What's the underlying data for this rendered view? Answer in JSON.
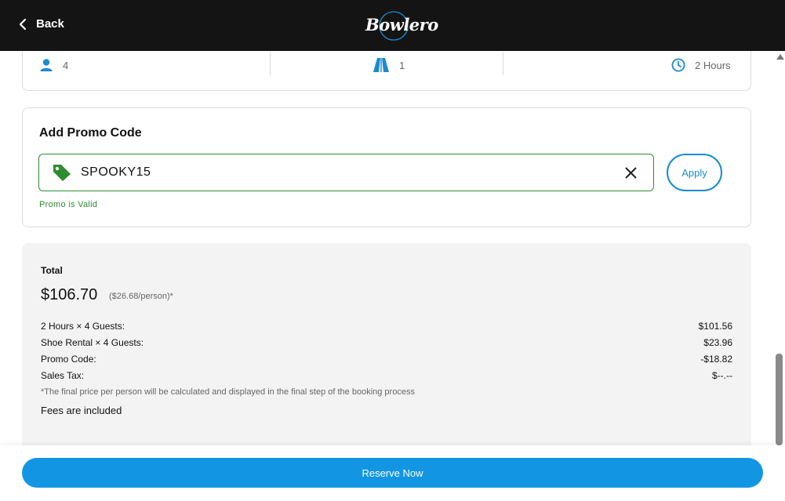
{
  "header": {
    "back_label": "Back",
    "logo_text": "Bowlero"
  },
  "summary": {
    "guests": "4",
    "lanes": "1",
    "duration": "2 Hours"
  },
  "promo": {
    "title": "Add Promo Code",
    "code": "SPOOKY15",
    "apply_label": "Apply",
    "status": "Promo is Valid",
    "valid_color": "#2e8b2e"
  },
  "total": {
    "label": "Total",
    "amount": "$106.70",
    "per_person": "($26.68/person)*",
    "lines": [
      {
        "label": "2 Hours × 4 Guests:",
        "value": "$101.56"
      },
      {
        "label": "Shoe Rental × 4 Guests:",
        "value": "$23.96"
      },
      {
        "label": "Promo Code:",
        "value": "-$18.82"
      },
      {
        "label": "Sales Tax:",
        "value": "$--.--"
      }
    ],
    "footnote": "*The final price per person will be calculated and displayed in the final step of the booking process",
    "fees_note": "Fees are included"
  },
  "actions": {
    "reserve_label": "Reserve Now",
    "accent_color": "#1296e4"
  },
  "icons": {
    "back": "chevron-left-icon",
    "guests": "person-icon",
    "lanes": "bowling-lane-icon",
    "duration": "clock-icon",
    "promo": "tag-icon",
    "clear": "close-icon"
  }
}
